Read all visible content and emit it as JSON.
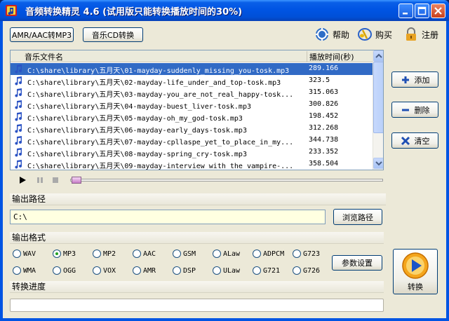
{
  "window": {
    "title": "音频转换精灵 4.6 (试用版只能转换播放时间的30%)"
  },
  "toolbar": {
    "mode_amr": "AMR/AAC转MP3",
    "mode_cd": "音乐CD转换",
    "help": "帮助",
    "buy": "购买",
    "register": "注册"
  },
  "file_list": {
    "col_name": "音乐文件名",
    "col_duration": "播放时间(秒)",
    "rows": [
      {
        "path": "C:\\share\\library\\五月天\\01-mayday-suddenly_missing_you-tosk.mp3",
        "duration": "289.166"
      },
      {
        "path": "C:\\share\\library\\五月天\\02-mayday-life_under_and_top-tosk.mp3",
        "duration": "323.5"
      },
      {
        "path": "C:\\share\\library\\五月天\\03-mayday-you_are_not_real_happy-tosk...",
        "duration": "315.063"
      },
      {
        "path": "C:\\share\\library\\五月天\\04-mayday-buest_liver-tosk.mp3",
        "duration": "300.826"
      },
      {
        "path": "C:\\share\\library\\五月天\\05-mayday-oh_my_god-tosk.mp3",
        "duration": "198.452"
      },
      {
        "path": "C:\\share\\library\\五月天\\06-mayday-early_days-tosk.mp3",
        "duration": "312.268"
      },
      {
        "path": "C:\\share\\library\\五月天\\07-mayday-cpllaspe_yet_to_place_in_my...",
        "duration": "344.738"
      },
      {
        "path": "C:\\share\\library\\五月天\\08-mayday-spring_cry-tosk.mp3",
        "duration": "233.352"
      },
      {
        "path": "C:\\share\\library\\五月天\\09-mayday-interview_with_the_vampire-...",
        "duration": "358.504"
      }
    ],
    "selected_index": 0
  },
  "side_buttons": {
    "add": "添加",
    "delete": "删除",
    "clear": "清空"
  },
  "output": {
    "path_label": "输出路径",
    "path_value": "C:\\",
    "browse": "浏览路径",
    "format_label": "输出格式",
    "formats_row1": [
      "WAV",
      "MP3",
      "MP2",
      "AAC",
      "GSM",
      "ALaw",
      "ADPCM",
      "G723"
    ],
    "formats_row2": [
      "WMA",
      "OGG",
      "VOX",
      "AMR",
      "DSP",
      "ULaw",
      "G721",
      "G726"
    ],
    "selected_format": "MP3",
    "settings": "参数设置",
    "progress_label": "转换进度",
    "progress": 0,
    "convert": "转换"
  },
  "colors": {
    "selection": "#316ac5",
    "title_bar": "#0054e3",
    "client_bg": "#ece9d8",
    "path_input_bg": "#ffffe1"
  }
}
